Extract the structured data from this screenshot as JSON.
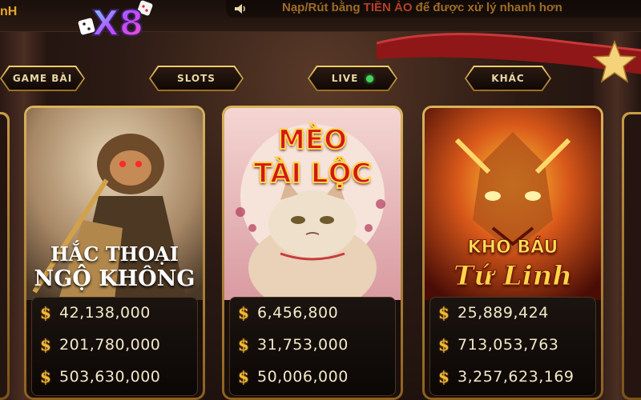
{
  "topbar": {
    "left_text": "nH",
    "logo_text": "X8",
    "ticker_parts": [
      "Nạp/Rút bằng ",
      "TIỀN ẢO",
      " để được xử lý nhanh hơn"
    ]
  },
  "tabs": [
    {
      "label": "GAME BÀI"
    },
    {
      "label": "SLOTS"
    },
    {
      "label": "LIVE",
      "status": "online"
    },
    {
      "label": "KHÁC"
    }
  ],
  "games": [
    {
      "title_line1": "HẮC THOẠI",
      "title_line2": "NGỘ KHÔNG",
      "jackpots": [
        "42,138,000",
        "201,780,000",
        "503,630,000"
      ]
    },
    {
      "title_line1": "MÈO",
      "title_line2": "TÀI LỘC",
      "jackpots": [
        "6,456,800",
        "31,753,000",
        "50,006,000"
      ]
    },
    {
      "title_line1": "KHO BÁU",
      "title_line2": "Tứ Linh",
      "jackpots": [
        "25,889,424",
        "713,053,763",
        "3,257,623,169"
      ]
    }
  ],
  "currency_symbol": "$",
  "colors": {
    "gold": "#e9b94a",
    "live_dot": "#42d45a",
    "ticker_highlight": "#d14a2c"
  }
}
